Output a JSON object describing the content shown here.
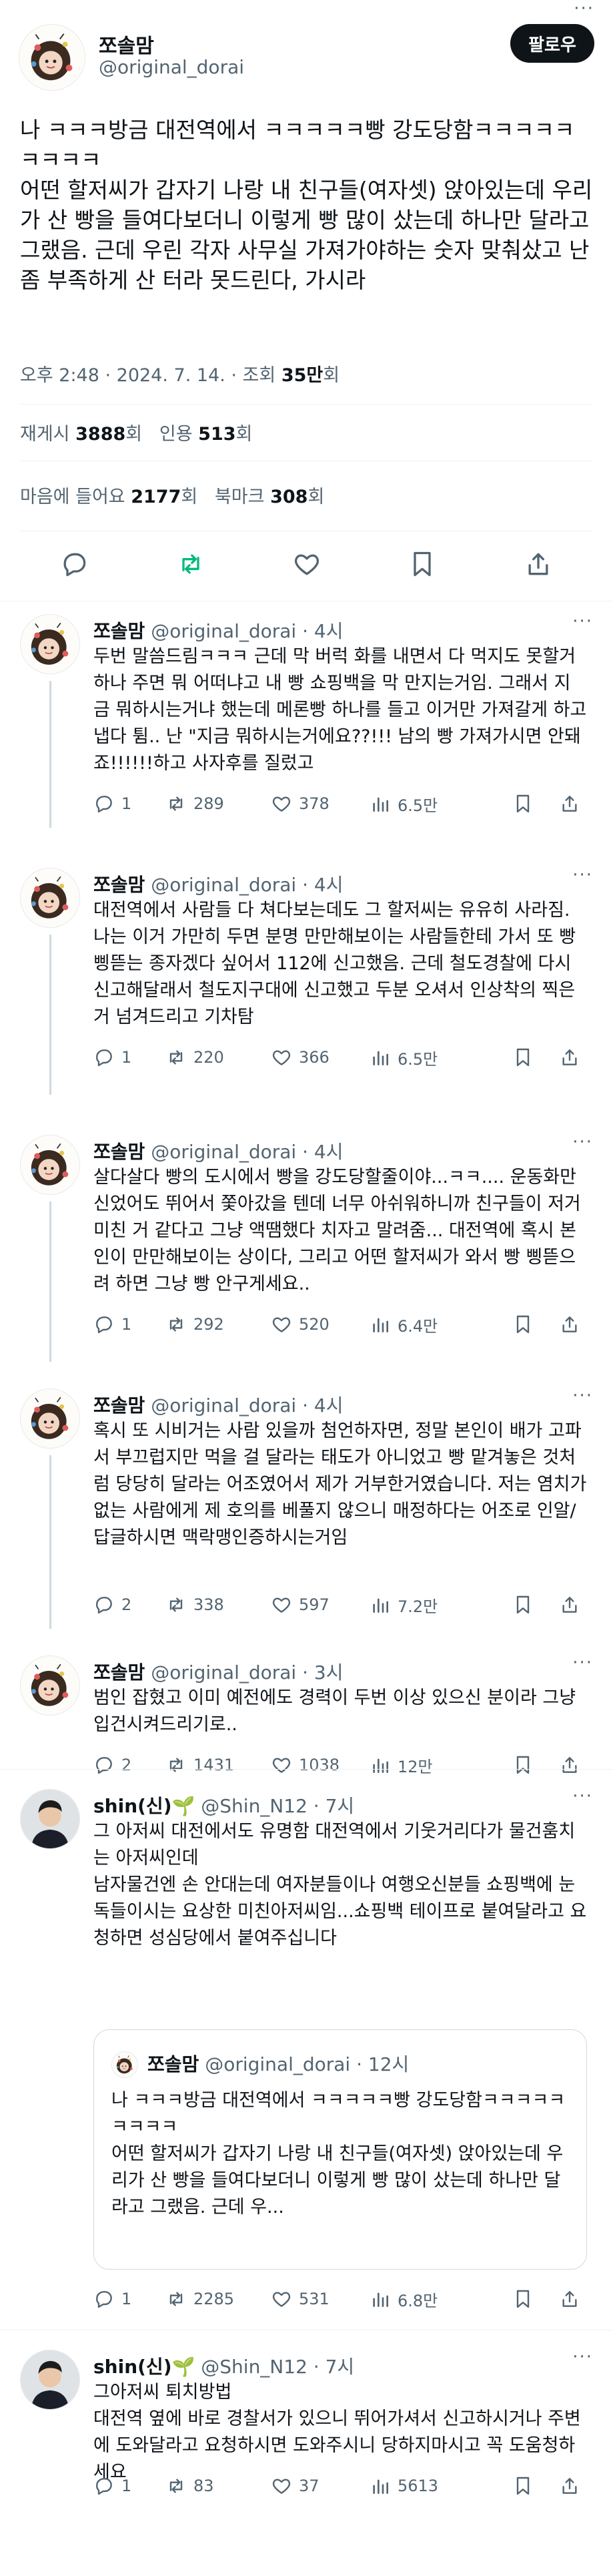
{
  "main_tweet": {
    "author_name": "쪼솔맘",
    "author_handle": "@original_dorai",
    "follow_label": "팔로우",
    "more_label": "···",
    "text": "나 ㅋㅋㅋ방금 대전역에서 ㅋㅋㅋㅋㅋ빵 강도당함ㅋㅋㅋㅋㅋㅋㅋㅋㅋ\n어떤 할저씨가 갑자기 나랑 내 친구들(여자셋) 앉아있는데 우리가 산 빵을 들여다보더니 이렇게 빵 많이 샀는데 하나만 달라고 그랬음. 근데 우린 각자 사무실 가져가야하는 숫자 맞춰샀고 난 좀 부족하게 산 터라 못드린다, 가시라",
    "time": "오후 2:48 · 2024. 7. 14. · 조회",
    "views": "35만",
    "views_unit": "회",
    "retweets_label": "재게시",
    "retweets": "3888",
    "quotes_label": "인용",
    "quotes": "513",
    "likes_label": "마음에 들어요",
    "likes": "2177",
    "bookmarks_label": "북마크",
    "bookmarks": "308",
    "count_unit": "회"
  },
  "replies": [
    {
      "author_name": "쪼솔맘",
      "author_handle": "@original_dorai",
      "time": "· 4시",
      "text": "두번 말씀드림ㅋㅋㅋ 근데 막 버럭 화를 내면서 다 먹지도 못할거 하나 주면 뭐 어떠냐고 내 빵 쇼핑백을 막 만지는거임. 그래서 지금 뭐하시는거냐 했는데 메론빵 하나를 들고 이거만 가져갈게 하고 냅다 튐.. 난 \"지금 뭐하시는거에요??!!! 남의 빵 가져가시면 안돼죠!!!!!!하고 사자후를 질렀고",
      "replies": "1",
      "retweets": "289",
      "likes": "378",
      "views": "6.5만"
    },
    {
      "author_name": "쪼솔맘",
      "author_handle": "@original_dorai",
      "time": "· 4시",
      "text": "대전역에서 사람들 다 쳐다보는데도 그 할저씨는 유유히 사라짐. 나는 이거 가만히 두면 분명 만만해보이는 사람들한테 가서 또 빵 삥뜯는 종자겠다 싶어서 112에 신고했음. 근데 철도경찰에 다시 신고해달래서 철도지구대에 신고했고 두분 오셔서 인상착의 찍은거 넘겨드리고 기차탐",
      "replies": "1",
      "retweets": "220",
      "likes": "366",
      "views": "6.5만"
    },
    {
      "author_name": "쪼솔맘",
      "author_handle": "@original_dorai",
      "time": "· 4시",
      "text": "살다살다 빵의 도시에서 빵을 강도당할줄이야...ㅋㅋ.... 운동화만 신었어도 뛰어서 쫓아갔을 텐데 너무 아쉬워하니까 친구들이 저거 미친 거 같다고 그냥 액땜했다 치자고 말려줌... 대전역에 혹시 본인이 만만해보이는 상이다, 그리고 어떤 할저씨가 와서 빵 삥뜯으려 하면 그냥 빵 안구게세요..",
      "replies": "1",
      "retweets": "292",
      "likes": "520",
      "views": "6.4만"
    },
    {
      "author_name": "쪼솔맘",
      "author_handle": "@original_dorai",
      "time": "· 4시",
      "text": "혹시 또 시비거는 사람 있을까 첨언하자면, 정말 본인이 배가 고파서 부끄럽지만 먹을 걸 달라는 태도가 아니었고 빵 맡겨놓은 것처럼 당당히 달라는 어조였어서 제가 거부한거였습니다. 저는 염치가 없는 사람에게 제 호의를 베풀지 않으니 매정하다는 어조로 인알/답글하시면 맥락맹인증하시는거임",
      "replies": "2",
      "retweets": "338",
      "likes": "597",
      "views": "7.2만"
    },
    {
      "author_name": "쪼솔맘",
      "author_handle": "@original_dorai",
      "time": "· 3시",
      "text": "범인 잡혔고 이미 예전에도 경력이 두번 이상 있으신 분이라 그냥 입건시켜드리기로..",
      "replies": "2",
      "retweets": "1431",
      "likes": "1038",
      "views": "12만"
    },
    {
      "author_name": "shin(신)🌱",
      "author_handle": "@Shin_N12",
      "time": "· 7시",
      "text": "그 아저씨 대전에서도 유명함 대전역에서 기웃거리다가 물건훔치는 아저씨인데\n남자물건엔 손 안대는데 여자분들이나 여행오신분들 쇼핑백에 눈독들이시는 요상한 미친아저씨임...쇼핑백 테이프로 붙여달라고 요청하면 성심당에서 붙여주십니다",
      "quote": {
        "author_name": "쪼솔맘",
        "author_handle": "@original_dorai",
        "time": "· 12시",
        "text": "나 ㅋㅋㅋ방금 대전역에서 ㅋㅋㅋㅋㅋ빵 강도당함ㅋㅋㅋㅋㅋㅋㅋㅋㅋ\n어떤 할저씨가 갑자기 나랑 내 친구들(여자셋) 앉아있는데 우리가 산 빵을 들여다보더니 이렇게 빵 많이 샀는데 하나만 달라고 그랬음. 근데 우..."
      },
      "replies": "1",
      "retweets": "2285",
      "likes": "531",
      "views": "6.8만"
    },
    {
      "author_name": "shin(신)🌱",
      "author_handle": "@Shin_N12",
      "time": "· 7시",
      "text": "그아저씨 퇴치방법\n대전역 옆에 바로 경찰서가 있으니 뛰어가셔서 신고하시거나 주변에 도와달라고 요청하시면 도와주시니 당하지마시고 꼭 도움청하세요",
      "replies": "1",
      "retweets": "83",
      "likes": "37",
      "views": "5613"
    }
  ]
}
